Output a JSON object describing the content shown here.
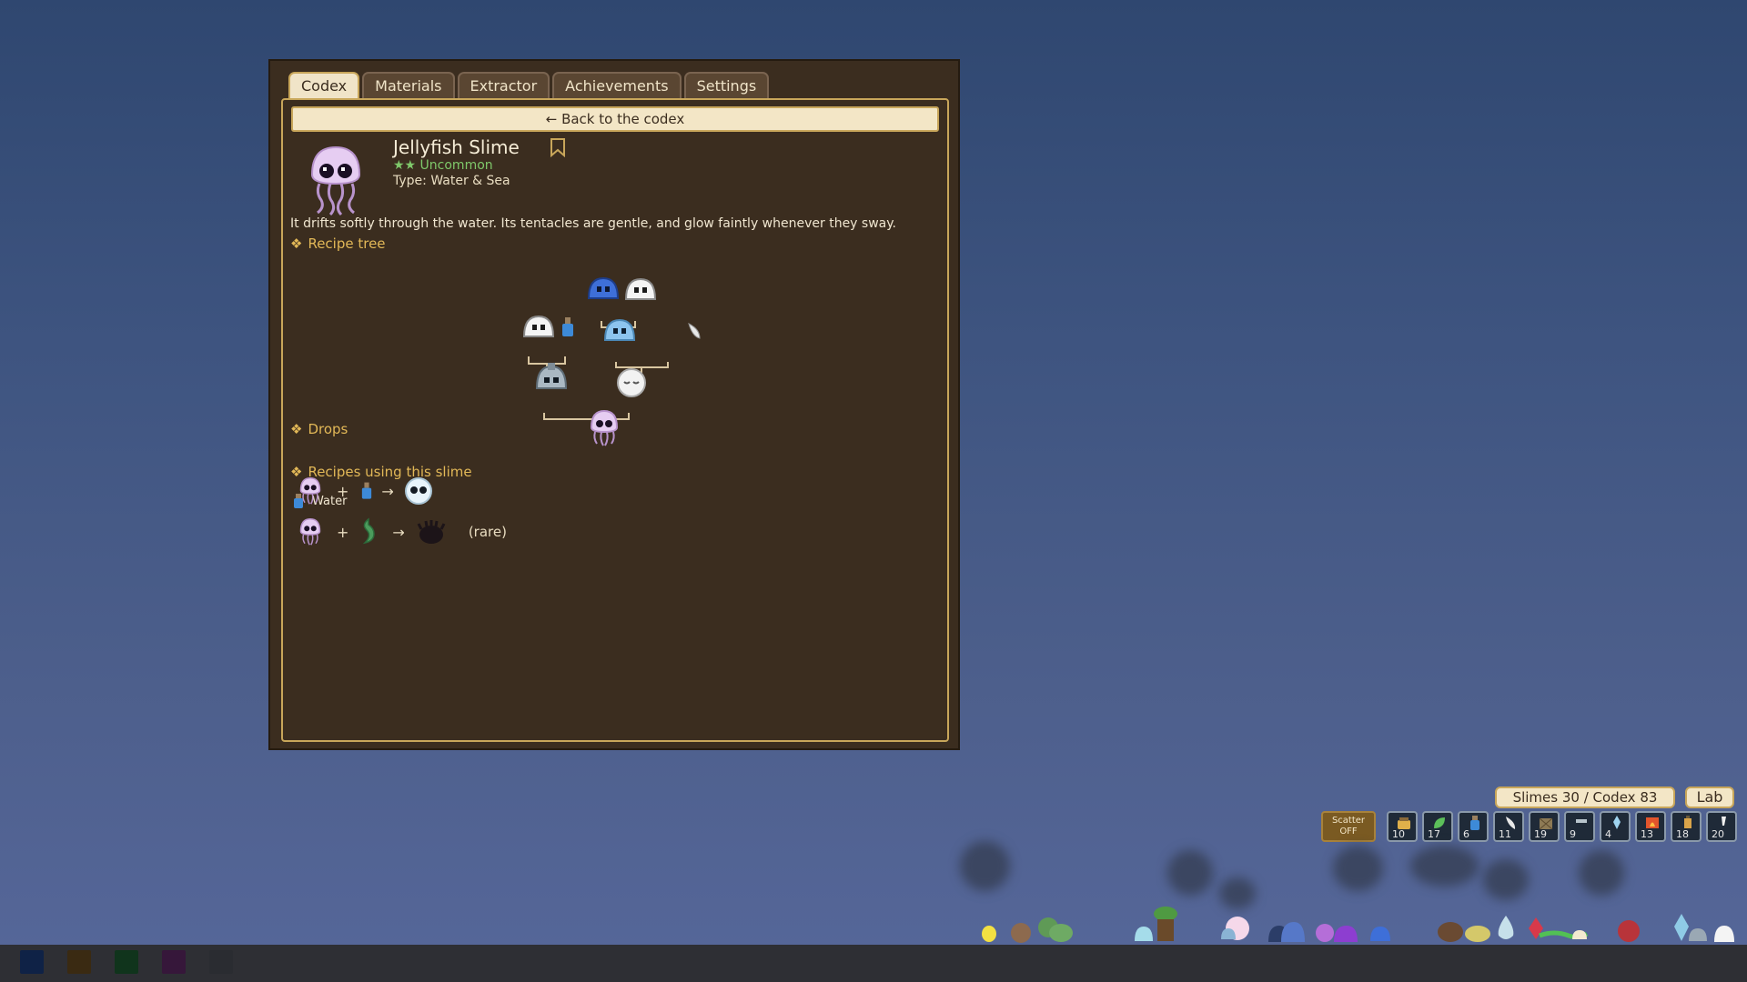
{
  "tabs": [
    {
      "label": "Codex",
      "active": true
    },
    {
      "label": "Materials",
      "active": false
    },
    {
      "label": "Extractor",
      "active": false
    },
    {
      "label": "Achievements",
      "active": false
    },
    {
      "label": "Settings",
      "active": false
    }
  ],
  "back_label": "← Back to the codex",
  "slime": {
    "name": "Jellyfish Slime",
    "rarity": "★★ Uncommon",
    "type": "Type: Water & Sea",
    "description": "It drifts softly through the water. Its tentacles are gentle, and glow faintly whenever they sway."
  },
  "sections": {
    "recipe_tree": "Recipe tree",
    "drops": "Drops",
    "recipes_using": "Recipes using this slime"
  },
  "section_marker": "❖",
  "drops": [
    {
      "label": "Water",
      "icon": "water-bottle-icon"
    }
  ],
  "recipes": [
    {
      "plus": "+",
      "arrow": "→",
      "note": ""
    },
    {
      "plus": "+",
      "arrow": "→",
      "note": "(rare)"
    }
  ],
  "hud": {
    "counter": "Slimes 30 / Codex 83",
    "lab": "Lab",
    "scatter_line1": "Scatter",
    "scatter_line2": "OFF",
    "inventory": [
      {
        "icon": "honey-jar-icon",
        "count": "10"
      },
      {
        "icon": "leaf-icon",
        "count": "17"
      },
      {
        "icon": "water-bottle-icon",
        "count": "6"
      },
      {
        "icon": "feather-icon",
        "count": "11"
      },
      {
        "icon": "crate-icon",
        "count": "19"
      },
      {
        "icon": "stone-icon",
        "count": "9"
      },
      {
        "icon": "crystal-icon",
        "count": "4"
      },
      {
        "icon": "fire-icon",
        "count": "13"
      },
      {
        "icon": "lantern-icon",
        "count": "18"
      },
      {
        "icon": "bone-icon",
        "count": "20"
      }
    ]
  },
  "colors": {
    "panel_bg": "#3b2d1f",
    "accent_gold": "#c8a65a",
    "heading_gold": "#e2b857",
    "uncommon_green": "#7fc86a",
    "jellyfish_lilac": "#e2c8f0"
  },
  "taskbar_swatches": [
    "#0f2246",
    "#3a2a12",
    "#10341c",
    "#36173a",
    "#2a2c31"
  ]
}
